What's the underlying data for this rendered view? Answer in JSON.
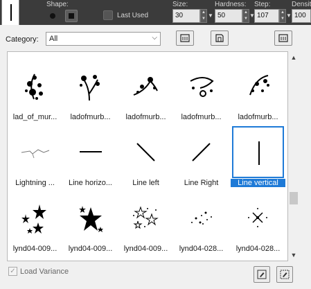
{
  "toolbar": {
    "shape_label": "Shape:",
    "last_used_label": "Last Used",
    "size_label": "Size:",
    "size_value": "30",
    "hardness_label": "Hardness:",
    "hardness_value": "50",
    "step_label": "Step:",
    "step_value": "107",
    "density_label": "Density:",
    "density_value": "100",
    "spin_up": "▲",
    "spin_down": "▼",
    "dropdown_arrow": "▼"
  },
  "category": {
    "label": "Category:",
    "selected": "All",
    "arrow": "⌵"
  },
  "brushes": [
    {
      "name": "lad_of_mur...",
      "icon": "floral-swirl-icon"
    },
    {
      "name": "ladofmurb...",
      "icon": "floral-flower-icon"
    },
    {
      "name": "ladofmurb...",
      "icon": "floral-scroll-icon"
    },
    {
      "name": "ladofmurb...",
      "icon": "floral-curl-icon"
    },
    {
      "name": "ladofmurb...",
      "icon": "floral-vine-icon"
    },
    {
      "name": "Lightning ...",
      "icon": "lightning-icon"
    },
    {
      "name": "Line horizo...",
      "icon": "line-horizontal-icon"
    },
    {
      "name": "Line left",
      "icon": "line-left-icon"
    },
    {
      "name": "Line Right",
      "icon": "line-right-icon"
    },
    {
      "name": "Line vertical",
      "icon": "line-vertical-icon",
      "selected": true
    },
    {
      "name": "lynd04-009...",
      "icon": "stars-cluster-icon"
    },
    {
      "name": "lynd04-009...",
      "icon": "stars-burst-icon"
    },
    {
      "name": "lynd04-009...",
      "icon": "stars-outline-icon"
    },
    {
      "name": "lynd04-028...",
      "icon": "sparkle-dots-icon"
    },
    {
      "name": "lynd04-028...",
      "icon": "sparkle-cross-icon"
    }
  ],
  "scroll": {
    "up": "▲",
    "down": "▼"
  },
  "footer": {
    "load_variance_label": "Load Variance",
    "load_variance_checked": true,
    "check_glyph": "✓"
  }
}
